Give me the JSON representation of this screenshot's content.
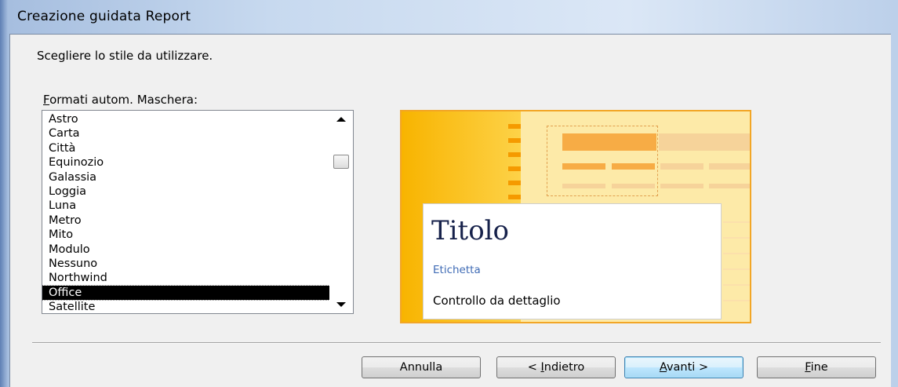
{
  "window": {
    "title": "Creazione guidata Report"
  },
  "instruction": "Scegliere lo stile da utilizzare.",
  "list": {
    "label_accel": "F",
    "label_rest": "ormati autom. Maschera:",
    "items": [
      "Astro",
      "Carta",
      "Città",
      "Equinozio",
      "Galassia",
      "Loggia",
      "Luna",
      "Metro",
      "Mito",
      "Modulo",
      "Nessuno",
      "Northwind",
      "Office",
      "Satellite"
    ],
    "selected": "Office"
  },
  "preview": {
    "title": "Titolo",
    "label": "Etichetta",
    "control": "Controllo da dettaglio"
  },
  "buttons": {
    "cancel": "Annulla",
    "back_pre": "< ",
    "back_accel": "I",
    "back_rest": "ndietro",
    "next_accel": "A",
    "next_rest": "vanti >",
    "finish_accel": "F",
    "finish_rest": "ine"
  },
  "colors": {
    "accent": "#f8b400",
    "selection": "#000000",
    "label_blue": "#3f6bb5"
  }
}
